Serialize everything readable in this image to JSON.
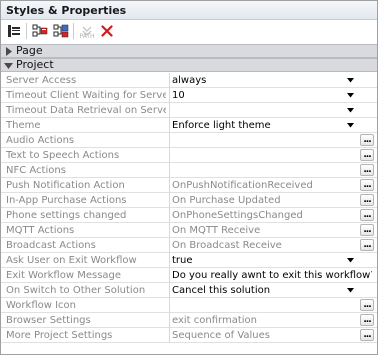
{
  "panel": {
    "title": "Styles & Properties"
  },
  "toolbar": {
    "paste_label": "PATH"
  },
  "sections": {
    "page": "Page",
    "project": "Project"
  },
  "rows": [
    {
      "name": "Server Access",
      "value": "always",
      "kind": "dropdown",
      "gray": false
    },
    {
      "name": "Timeout Client Waiting for Server",
      "value": "10",
      "kind": "dropdown",
      "gray": false
    },
    {
      "name": "Timeout Data Retrieval on Server",
      "value": "",
      "kind": "dropdown",
      "gray": false
    },
    {
      "name": "Theme",
      "value": "Enforce light theme",
      "kind": "dropdown",
      "gray": false
    },
    {
      "name": "Audio Actions",
      "value": "",
      "kind": "ellipsis",
      "gray": false
    },
    {
      "name": "Text to Speech Actions",
      "value": "",
      "kind": "ellipsis",
      "gray": false
    },
    {
      "name": "NFC Actions",
      "value": "",
      "kind": "ellipsis",
      "gray": false
    },
    {
      "name": "Push Notification Action",
      "value": "OnPushNotificationReceived",
      "kind": "ellipsis",
      "gray": true
    },
    {
      "name": "In-App Purchase Actions",
      "value": "On Purchase Updated",
      "kind": "ellipsis",
      "gray": true
    },
    {
      "name": "Phone settings changed",
      "value": "OnPhoneSettingsChanged",
      "kind": "ellipsis",
      "gray": true
    },
    {
      "name": "MQTT Actions",
      "value": "On MQTT Receive",
      "kind": "ellipsis",
      "gray": true
    },
    {
      "name": "Broadcast Actions",
      "value": "On Broadcast Receive",
      "kind": "ellipsis",
      "gray": true
    },
    {
      "name": "Ask User on Exit Workflow",
      "value": "true",
      "kind": "dropdown",
      "gray": false
    },
    {
      "name": "Exit Workflow Message",
      "value": "Do you really awnt to exit this workflow?",
      "kind": "text",
      "gray": false
    },
    {
      "name": "On Switch to Other Solution",
      "value": "Cancel this solution",
      "kind": "dropdown",
      "gray": false
    },
    {
      "name": "Workflow Icon",
      "value": "",
      "kind": "ellipsis",
      "gray": false
    },
    {
      "name": "Browser Settings",
      "value": "exit confirmation",
      "kind": "ellipsis",
      "gray": true
    },
    {
      "name": "More Project Settings",
      "value": "Sequence of Values",
      "kind": "ellipsis",
      "gray": true
    }
  ]
}
